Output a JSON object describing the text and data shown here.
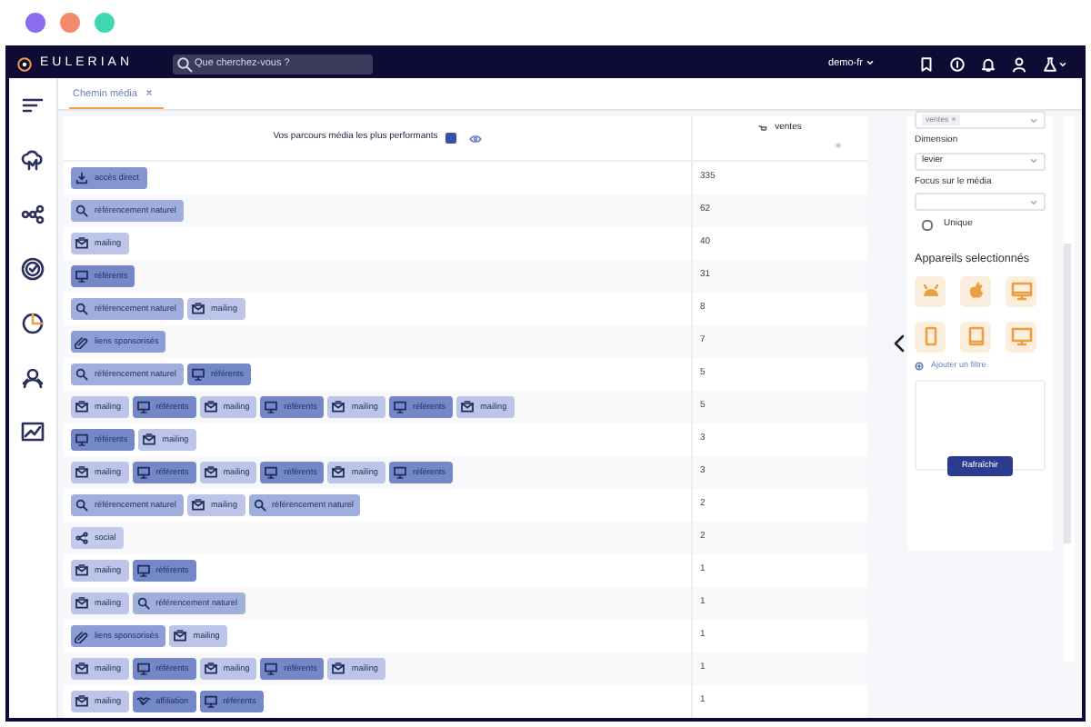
{
  "window_dots": [
    {
      "color": "#8b6cf0"
    },
    {
      "color": "#f28b6d"
    },
    {
      "color": "#3fd6b4"
    }
  ],
  "header": {
    "logo": "EULERIAN",
    "search": {
      "placeholder": "Que cherchez-vous ?"
    },
    "account": "demo-fr"
  },
  "tabs": [
    {
      "label": "Chemin média",
      "selected": true
    }
  ],
  "table": {
    "title": "Vos parcours média les plus performants",
    "columns": [
      "ventes"
    ],
    "rows": [
      {
        "path": [
          {
            "kind": "direct",
            "label": "accès direct"
          }
        ],
        "ventes": "335"
      },
      {
        "path": [
          {
            "kind": "search",
            "label": "référencement naturel"
          }
        ],
        "ventes": "62"
      },
      {
        "path": [
          {
            "kind": "mailing",
            "label": "mailing"
          }
        ],
        "ventes": "40"
      },
      {
        "path": [
          {
            "kind": "referrer",
            "label": "référents"
          }
        ],
        "ventes": "31"
      },
      {
        "path": [
          {
            "kind": "search",
            "label": "référencement naturel"
          },
          {
            "kind": "mailing",
            "label": "mailing"
          }
        ],
        "ventes": "8"
      },
      {
        "path": [
          {
            "kind": "sponsored",
            "label": "liens sponsorisés"
          }
        ],
        "ventes": "7"
      },
      {
        "path": [
          {
            "kind": "search",
            "label": "référencement naturel"
          },
          {
            "kind": "referrer",
            "label": "référents"
          }
        ],
        "ventes": "5"
      },
      {
        "path": [
          {
            "kind": "mailing",
            "label": "mailing"
          },
          {
            "kind": "referrer",
            "label": "référents"
          },
          {
            "kind": "mailing",
            "label": "mailing"
          },
          {
            "kind": "referrer",
            "label": "référents"
          },
          {
            "kind": "mailing",
            "label": "mailing"
          },
          {
            "kind": "referrer",
            "label": "référents"
          },
          {
            "kind": "mailing",
            "label": "mailing"
          }
        ],
        "ventes": "5"
      },
      {
        "path": [
          {
            "kind": "referrer",
            "label": "référents"
          },
          {
            "kind": "mailing",
            "label": "mailing"
          }
        ],
        "ventes": "3"
      },
      {
        "path": [
          {
            "kind": "mailing",
            "label": "mailing"
          },
          {
            "kind": "referrer",
            "label": "référents"
          },
          {
            "kind": "mailing",
            "label": "mailing"
          },
          {
            "kind": "referrer",
            "label": "référents"
          },
          {
            "kind": "mailing",
            "label": "mailing"
          },
          {
            "kind": "referrer",
            "label": "référents"
          }
        ],
        "ventes": "3"
      },
      {
        "path": [
          {
            "kind": "search",
            "label": "référencement naturel"
          },
          {
            "kind": "mailing",
            "label": "mailing"
          },
          {
            "kind": "search",
            "label": "référencement naturel"
          }
        ],
        "ventes": "2"
      },
      {
        "path": [
          {
            "kind": "social",
            "label": "social"
          }
        ],
        "ventes": "2"
      },
      {
        "path": [
          {
            "kind": "mailing",
            "label": "mailing"
          },
          {
            "kind": "referrer",
            "label": "référents"
          }
        ],
        "ventes": "1"
      },
      {
        "path": [
          {
            "kind": "mailing",
            "label": "mailing"
          },
          {
            "kind": "search",
            "label": "référencement naturel"
          }
        ],
        "ventes": "1"
      },
      {
        "path": [
          {
            "kind": "sponsored",
            "label": "liens sponsorisés"
          },
          {
            "kind": "mailing",
            "label": "mailing"
          }
        ],
        "ventes": "1"
      },
      {
        "path": [
          {
            "kind": "mailing",
            "label": "mailing"
          },
          {
            "kind": "referrer",
            "label": "référents"
          },
          {
            "kind": "mailing",
            "label": "mailing"
          },
          {
            "kind": "referrer",
            "label": "référents"
          },
          {
            "kind": "mailing",
            "label": "mailing"
          }
        ],
        "ventes": "1"
      },
      {
        "path": [
          {
            "kind": "mailing",
            "label": "mailing"
          },
          {
            "kind": "affiliation",
            "label": "affiliation"
          },
          {
            "kind": "referrer",
            "label": "référents"
          }
        ],
        "ventes": "1"
      }
    ]
  },
  "panel": {
    "metric": "ventes",
    "fields": [
      {
        "label": "Dimension",
        "value": "levier"
      },
      {
        "label": "Focus sur le média"
      }
    ],
    "unique": {
      "label": "Unique",
      "checked": false
    },
    "devices_title": "Appareils selectionnés",
    "devices": [
      {
        "kind": "android"
      },
      {
        "kind": "apple"
      },
      {
        "kind": "desktop"
      },
      {
        "kind": "phone"
      },
      {
        "kind": "tablet"
      },
      {
        "kind": "monitor"
      }
    ],
    "add_filter": "Ajouter un filtre",
    "refresh": "Rafraîchir"
  }
}
